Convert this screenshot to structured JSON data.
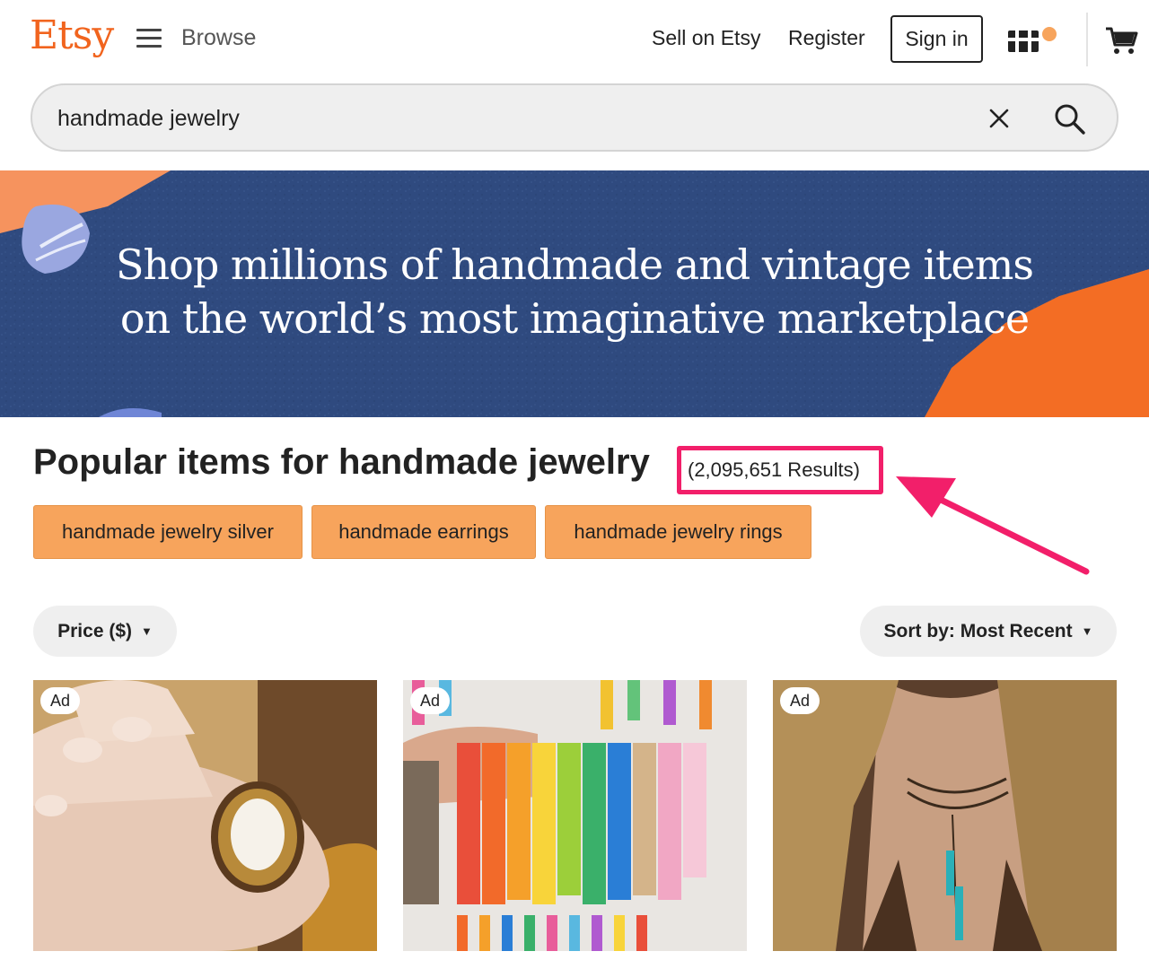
{
  "header": {
    "logo": "Etsy",
    "browse_label": "Browse",
    "sell_label": "Sell on Etsy",
    "register_label": "Register",
    "signin_label": "Sign in"
  },
  "search": {
    "value": "handmade jewelry"
  },
  "banner": {
    "line1": "Shop millions of handmade and vintage items",
    "line2": "on the world’s most imaginative marketplace"
  },
  "results": {
    "heading": "Popular items for handmade jewelry",
    "count": "(2,095,651 Results)"
  },
  "chips": [
    {
      "label": "handmade jewelry silver"
    },
    {
      "label": "handmade earrings"
    },
    {
      "label": "handmade jewelry rings"
    }
  ],
  "filters": {
    "price_label": "Price ($)",
    "sort_label": "Sort by: Most Recent"
  },
  "listings": [
    {
      "badge": "Ad",
      "image": "ring-on-hand-photo"
    },
    {
      "badge": "Ad",
      "image": "colorful-tassels-photo"
    },
    {
      "badge": "Ad",
      "image": "turquoise-necklace-photo"
    }
  ],
  "colors": {
    "brand": "#F1641E",
    "chip": "#F7A45C",
    "highlight": "#F21F6A",
    "banner": "#2f4a7f"
  }
}
